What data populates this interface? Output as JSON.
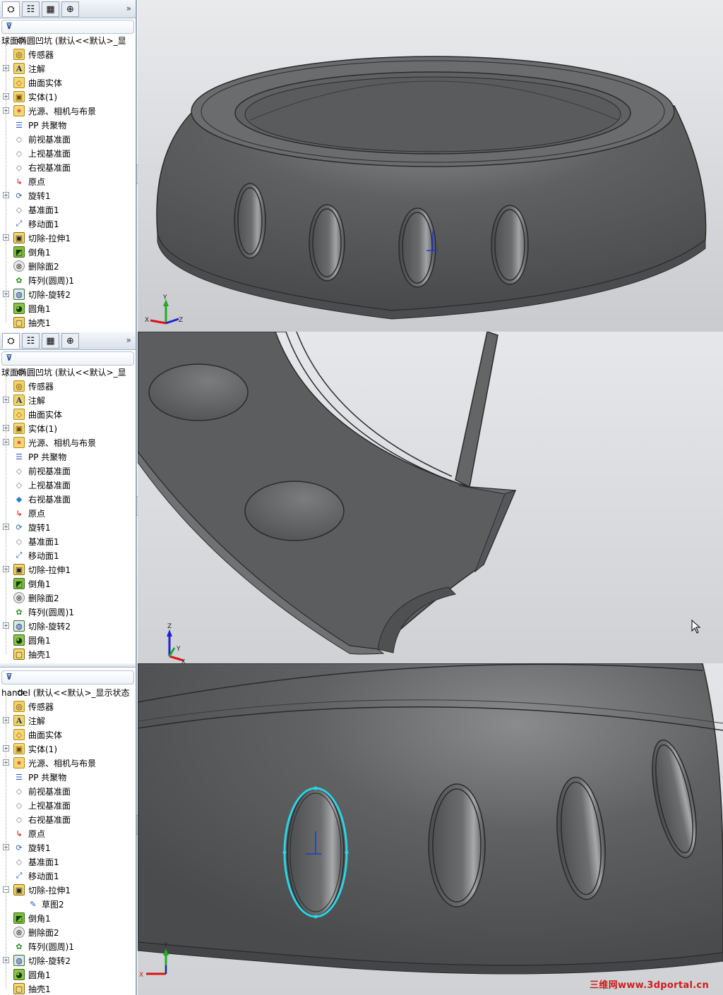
{
  "panels": [
    {
      "root_title": "球面椭圆凹坑 (默认<<默认>_显",
      "items": [
        {
          "label": "传感器",
          "icon": "sensor-icon",
          "glyph": "◎",
          "cls": "i-sensor",
          "exp": false
        },
        {
          "label": "注解",
          "icon": "annotation-icon",
          "glyph": "A",
          "cls": "i-note",
          "exp": true
        },
        {
          "label": "曲面实体",
          "icon": "surface-body-icon",
          "glyph": "◇",
          "cls": "i-surf",
          "exp": false
        },
        {
          "label": "实体(1)",
          "icon": "solid-body-icon",
          "glyph": "▣",
          "cls": "i-solid",
          "exp": true
        },
        {
          "label": "光源、相机与布景",
          "icon": "lights-camera-icon",
          "glyph": "✶",
          "cls": "i-light",
          "exp": true
        },
        {
          "label": "PP 共聚物",
          "icon": "material-icon",
          "glyph": "☰",
          "cls": "i-mat",
          "exp": false
        },
        {
          "label": "前视基准面",
          "icon": "plane-icon",
          "glyph": "◇",
          "cls": "i-plane",
          "exp": false
        },
        {
          "label": "上视基准面",
          "icon": "plane-icon",
          "glyph": "◇",
          "cls": "i-plane",
          "exp": false
        },
        {
          "label": "右视基准面",
          "icon": "plane-icon",
          "glyph": "◇",
          "cls": "i-plane",
          "exp": false
        },
        {
          "label": "原点",
          "icon": "origin-icon",
          "glyph": "↳",
          "cls": "i-origin",
          "exp": false
        },
        {
          "label": "旋转1",
          "icon": "revolve-icon",
          "glyph": "⟳",
          "cls": "i-rev",
          "exp": true
        },
        {
          "label": "基准面1",
          "icon": "plane-icon",
          "glyph": "◇",
          "cls": "i-plane",
          "exp": false
        },
        {
          "label": "移动面1",
          "icon": "move-face-icon",
          "glyph": "⤢",
          "cls": "i-move",
          "exp": false
        },
        {
          "label": "切除-拉伸1",
          "icon": "cut-extrude-icon",
          "glyph": "▣",
          "cls": "i-cut",
          "exp": true
        },
        {
          "label": "倒角1",
          "icon": "chamfer-icon",
          "glyph": "◩",
          "cls": "i-chamfer",
          "exp": false
        },
        {
          "label": "删除面2",
          "icon": "delete-face-icon",
          "glyph": "⊗",
          "cls": "i-del",
          "exp": false
        },
        {
          "label": "阵列(圆周)1",
          "icon": "circular-pattern-icon",
          "glyph": "✿",
          "cls": "i-pat",
          "exp": false
        },
        {
          "label": "切除-旋转2",
          "icon": "cut-revolve-icon",
          "glyph": "◍",
          "cls": "i-cutrev",
          "exp": true
        },
        {
          "label": "圆角1",
          "icon": "fillet-icon",
          "glyph": "◕",
          "cls": "i-fillet",
          "exp": false
        },
        {
          "label": "抽壳1",
          "icon": "shell-icon",
          "glyph": "▢",
          "cls": "i-shell",
          "exp": false
        }
      ]
    },
    {
      "root_title": "球面椭圆凹坑 (默认<<默认>_显",
      "items": [
        {
          "label": "传感器",
          "icon": "sensor-icon",
          "glyph": "◎",
          "cls": "i-sensor",
          "exp": false
        },
        {
          "label": "注解",
          "icon": "annotation-icon",
          "glyph": "A",
          "cls": "i-note",
          "exp": true
        },
        {
          "label": "曲面实体",
          "icon": "surface-body-icon",
          "glyph": "◇",
          "cls": "i-surf",
          "exp": false
        },
        {
          "label": "实体(1)",
          "icon": "solid-body-icon",
          "glyph": "▣",
          "cls": "i-solid",
          "exp": true
        },
        {
          "label": "光源、相机与布景",
          "icon": "lights-camera-icon",
          "glyph": "✶",
          "cls": "i-light",
          "exp": true
        },
        {
          "label": "PP 共聚物",
          "icon": "material-icon",
          "glyph": "☰",
          "cls": "i-mat",
          "exp": false
        },
        {
          "label": "前视基准面",
          "icon": "plane-icon",
          "glyph": "◇",
          "cls": "i-plane",
          "exp": false
        },
        {
          "label": "上视基准面",
          "icon": "plane-icon",
          "glyph": "◇",
          "cls": "i-plane",
          "exp": false
        },
        {
          "label": "右视基准面",
          "icon": "plane-selected-icon",
          "glyph": "◆",
          "cls": "i-plane-sel",
          "exp": false
        },
        {
          "label": "原点",
          "icon": "origin-icon",
          "glyph": "↳",
          "cls": "i-origin",
          "exp": false
        },
        {
          "label": "旋转1",
          "icon": "revolve-icon",
          "glyph": "⟳",
          "cls": "i-rev",
          "exp": true
        },
        {
          "label": "基准面1",
          "icon": "plane-icon",
          "glyph": "◇",
          "cls": "i-plane",
          "exp": false
        },
        {
          "label": "移动面1",
          "icon": "move-face-icon",
          "glyph": "⤢",
          "cls": "i-move",
          "exp": false
        },
        {
          "label": "切除-拉伸1",
          "icon": "cut-extrude-icon",
          "glyph": "▣",
          "cls": "i-cut",
          "exp": true
        },
        {
          "label": "倒角1",
          "icon": "chamfer-icon",
          "glyph": "◩",
          "cls": "i-chamfer",
          "exp": false
        },
        {
          "label": "删除面2",
          "icon": "delete-face-icon",
          "glyph": "⊗",
          "cls": "i-del",
          "exp": false
        },
        {
          "label": "阵列(圆周)1",
          "icon": "circular-pattern-icon",
          "glyph": "✿",
          "cls": "i-pat",
          "exp": false
        },
        {
          "label": "切除-旋转2",
          "icon": "cut-revolve-icon",
          "glyph": "◍",
          "cls": "i-cutrev",
          "exp": true
        },
        {
          "label": "圆角1",
          "icon": "fillet-icon",
          "glyph": "◕",
          "cls": "i-fillet",
          "exp": false
        },
        {
          "label": "抽壳1",
          "icon": "shell-icon",
          "glyph": "▢",
          "cls": "i-shell",
          "exp": false
        }
      ]
    },
    {
      "root_title": "handel (默认<<默认>_显示状态",
      "items": [
        {
          "label": "传感器",
          "icon": "sensor-icon",
          "glyph": "◎",
          "cls": "i-sensor",
          "exp": false
        },
        {
          "label": "注解",
          "icon": "annotation-icon",
          "glyph": "A",
          "cls": "i-note",
          "exp": true
        },
        {
          "label": "曲面实体",
          "icon": "surface-body-icon",
          "glyph": "◇",
          "cls": "i-surf",
          "exp": false
        },
        {
          "label": "实体(1)",
          "icon": "solid-body-icon",
          "glyph": "▣",
          "cls": "i-solid",
          "exp": true
        },
        {
          "label": "光源、相机与布景",
          "icon": "lights-camera-icon",
          "glyph": "✶",
          "cls": "i-light",
          "exp": true
        },
        {
          "label": "PP 共聚物",
          "icon": "material-icon",
          "glyph": "☰",
          "cls": "i-mat",
          "exp": false
        },
        {
          "label": "前视基准面",
          "icon": "plane-icon",
          "glyph": "◇",
          "cls": "i-plane",
          "exp": false
        },
        {
          "label": "上视基准面",
          "icon": "plane-icon",
          "glyph": "◇",
          "cls": "i-plane",
          "exp": false
        },
        {
          "label": "右视基准面",
          "icon": "plane-icon",
          "glyph": "◇",
          "cls": "i-plane",
          "exp": false
        },
        {
          "label": "原点",
          "icon": "origin-icon",
          "glyph": "↳",
          "cls": "i-origin",
          "exp": false
        },
        {
          "label": "旋转1",
          "icon": "revolve-icon",
          "glyph": "⟳",
          "cls": "i-rev",
          "exp": true
        },
        {
          "label": "基准面1",
          "icon": "plane-icon",
          "glyph": "◇",
          "cls": "i-plane",
          "exp": false
        },
        {
          "label": "移动面1",
          "icon": "move-face-icon",
          "glyph": "⤢",
          "cls": "i-move",
          "exp": false
        },
        {
          "label": "切除-拉伸1",
          "icon": "cut-extrude-icon",
          "glyph": "▣",
          "cls": "i-cut",
          "exp": true,
          "open": true
        },
        {
          "label": "草图2",
          "icon": "sketch-icon",
          "glyph": "✎",
          "cls": "i-sketch",
          "exp": false,
          "sub": true
        },
        {
          "label": "倒角1",
          "icon": "chamfer-icon",
          "glyph": "◩",
          "cls": "i-chamfer",
          "exp": false
        },
        {
          "label": "删除面2",
          "icon": "delete-face-icon",
          "glyph": "⊗",
          "cls": "i-del",
          "exp": false
        },
        {
          "label": "阵列(圆周)1",
          "icon": "circular-pattern-icon",
          "glyph": "✿",
          "cls": "i-pat",
          "exp": false
        },
        {
          "label": "切除-旋转2",
          "icon": "cut-revolve-icon",
          "glyph": "◍",
          "cls": "i-cutrev",
          "exp": true
        },
        {
          "label": "圆角1",
          "icon": "fillet-icon",
          "glyph": "◕",
          "cls": "i-fillet",
          "exp": false
        },
        {
          "label": "抽壳1",
          "icon": "shell-icon",
          "glyph": "▢",
          "cls": "i-shell",
          "exp": false
        }
      ]
    }
  ],
  "tabs": [
    {
      "icon": "feature-manager-icon",
      "glyph": "⛭"
    },
    {
      "icon": "property-manager-icon",
      "glyph": "☷"
    },
    {
      "icon": "configuration-manager-icon",
      "glyph": "▦"
    },
    {
      "icon": "dimxpert-icon",
      "glyph": "⊕"
    }
  ],
  "tabs_more": "»",
  "filter_glyph": "⊽",
  "grip_glyph": "‹",
  "axis_labels": {
    "x": "X",
    "y": "Y",
    "z": "Z"
  },
  "watermark": {
    "prefix": "三维网",
    "suffix": "www.3dportal.cn"
  },
  "colors": {
    "viewport_bg": "#d6d8dc",
    "model_gray": "#5c5d5f",
    "selection_cyan": "#29d6e6",
    "axis_red": "#d11",
    "axis_green": "#2a2",
    "axis_blue": "#22c"
  }
}
